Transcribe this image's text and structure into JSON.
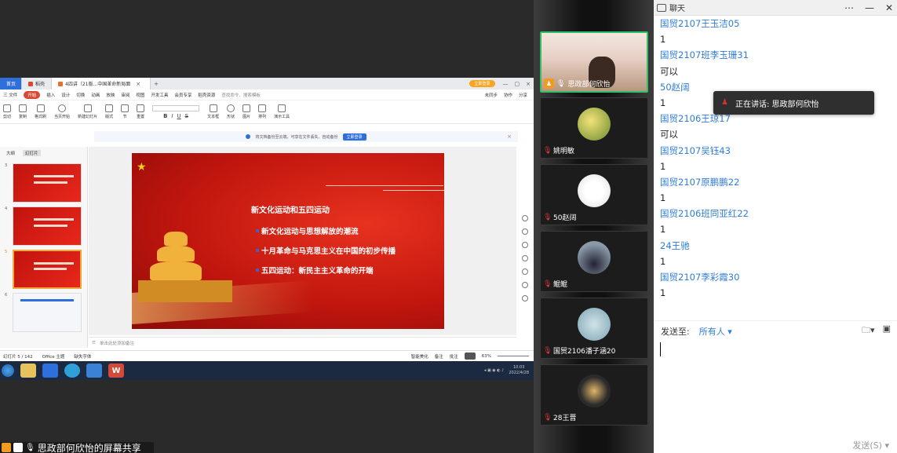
{
  "screen_share": {
    "caption": "思政部何欣怡的屏幕共享",
    "wps": {
      "tabs": [
        {
          "label": "首页",
          "type": "home"
        },
        {
          "label": "稻壳",
          "type": "normal"
        },
        {
          "label": "4四讲（21版...中国革命新局面",
          "type": "active"
        }
      ],
      "login_btn": "立即登录",
      "menu": [
        "三 文件",
        "开始",
        "插入",
        "设计",
        "切换",
        "动画",
        "放映",
        "审阅",
        "视图",
        "开发工具",
        "会员专享",
        "稻壳资源"
      ],
      "menu_active_index": 1,
      "search": "查找命令、搜索模板",
      "right_tools": [
        "未同步",
        "协作",
        "分享"
      ],
      "ribbon": [
        "剪切",
        "复制",
        "格式刷",
        "当页开始",
        "新建幻灯片",
        "版式",
        "节",
        "重置",
        "文本框",
        "形状",
        "图片",
        "排列",
        "演示工具"
      ],
      "notice": {
        "text": "将文档备份至云端，可享在文件丢失、自动备份",
        "button": "立即登录"
      },
      "panel_tabs": [
        "大纲",
        "幻灯片"
      ],
      "thumbnails": [
        "3",
        "4",
        "5",
        "6"
      ],
      "selected_thumb": "5",
      "slide": {
        "title": "新文化运动和五四运动",
        "bullets": [
          "新文化运动与思想解放的潮流",
          "十月革命与马克思主义在中国的初步传播",
          "五四运动：新民主主义革命的开端"
        ]
      },
      "notes_placeholder": "单击此处添加备注",
      "status": {
        "slide_info": "幻灯片 5 / 142",
        "theme": "Office 主题",
        "missing_font": "缺失字体",
        "beautify": "智能美化",
        "notes": "备注",
        "comments": "批注",
        "zoom": "63%"
      },
      "clock": {
        "time": "10:03",
        "date": "2022/4/28"
      }
    }
  },
  "participants": [
    {
      "name": "思政部何欣怡",
      "kind": "camera",
      "speaking": true
    },
    {
      "name": "姚明敏",
      "kind": "avatar",
      "avatar": "av-1"
    },
    {
      "name": "50赵阔",
      "kind": "avatar",
      "avatar": "av-2"
    },
    {
      "name": "鲲鲲",
      "kind": "avatar",
      "avatar": "av-3"
    },
    {
      "name": "国贸2106潘子涵20",
      "kind": "avatar",
      "avatar": "av-4"
    },
    {
      "name": "28王晋",
      "kind": "avatar",
      "avatar": "av-5"
    }
  ],
  "chat": {
    "title": "聊天",
    "messages": [
      {
        "sender": "国贸2107王玉洁05",
        "text": "1"
      },
      {
        "sender": "国贸2107班李玉珊31",
        "text": "可以"
      },
      {
        "sender": "50赵阔",
        "text": "1"
      },
      {
        "sender": "国贸2106王琼17",
        "text": "可以"
      },
      {
        "sender": "国贸2107吴钰43",
        "text": "1"
      },
      {
        "sender": "国贸2107原鹏鹏22",
        "text": "1"
      },
      {
        "sender": "国贸2106班同亚红22",
        "text": "1"
      },
      {
        "sender": "24王驰",
        "text": "1"
      },
      {
        "sender": "国贸2107李彩霞30",
        "text": "1"
      }
    ],
    "speaking_toast": "正在讲话: 思政部何欣怡",
    "send_to_label": "发送至:",
    "send_to_value": "所有人 ▾",
    "send_button": "发送(S)",
    "input_value": ""
  },
  "colors": {
    "accent_blue": "#2f7ddb",
    "wps_red": "#d64937",
    "speaking_green": "#2fc066"
  }
}
